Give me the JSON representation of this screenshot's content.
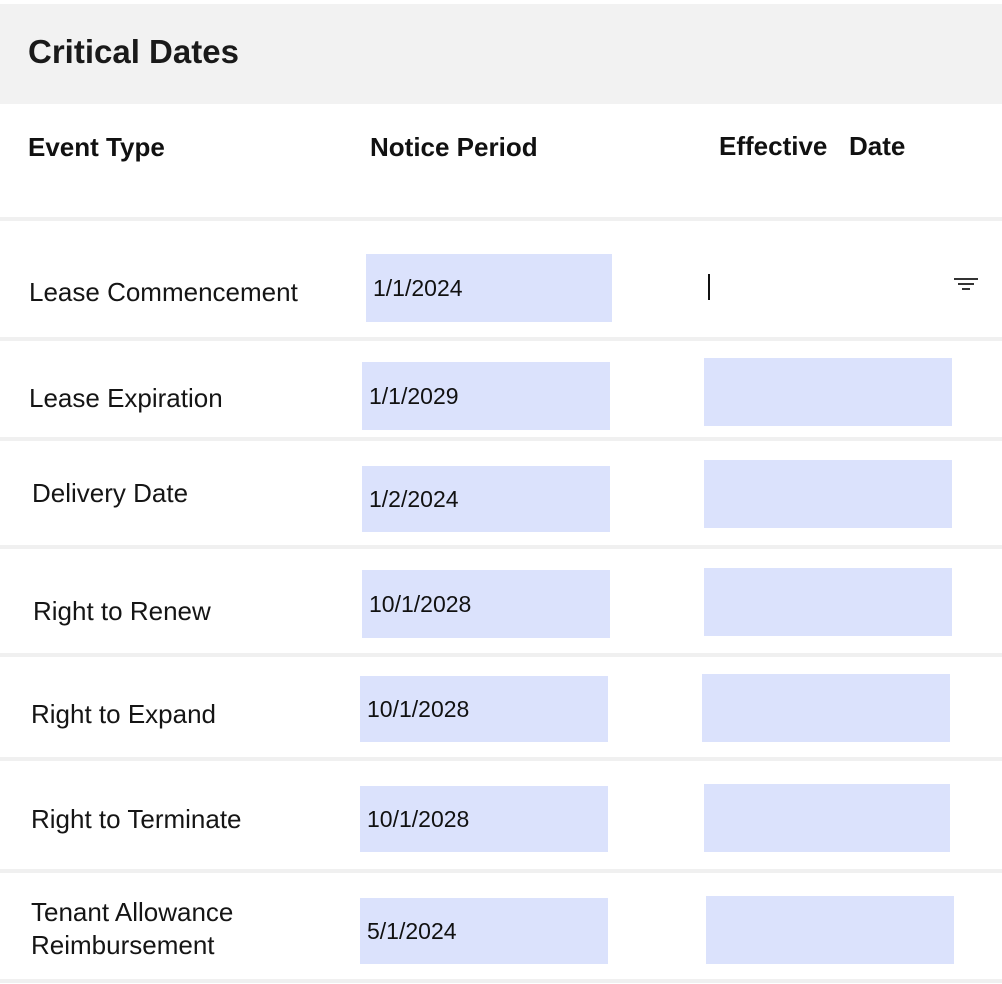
{
  "header": {
    "title": "Critical Dates"
  },
  "columns": {
    "event_type": "Event Type",
    "notice_period": "Notice Period",
    "effective_date_1": "Effective",
    "effective_date_2": "Date"
  },
  "rows": [
    {
      "label": "Lease Commencement",
      "notice_period": "1/1/2024",
      "effective_date": ""
    },
    {
      "label": "Lease Expiration",
      "notice_period": "1/1/2029",
      "effective_date": ""
    },
    {
      "label": "Delivery Date",
      "notice_period": "1/2/2024",
      "effective_date": ""
    },
    {
      "label": "Right to Renew",
      "notice_period": "10/1/2028",
      "effective_date": ""
    },
    {
      "label": "Right to Expand",
      "notice_period": "10/1/2028",
      "effective_date": ""
    },
    {
      "label": "Right to Terminate",
      "notice_period": "10/1/2028",
      "effective_date": ""
    },
    {
      "label_line1": "Tenant Allowance",
      "label_line2": "Reimbursement",
      "notice_period": "5/1/2024",
      "effective_date": ""
    }
  ],
  "icons": {
    "filter": "filter-icon"
  },
  "colors": {
    "field_bg": "#dbe2fc",
    "header_bg": "#f2f2f2",
    "divider": "#f0f0f0"
  }
}
